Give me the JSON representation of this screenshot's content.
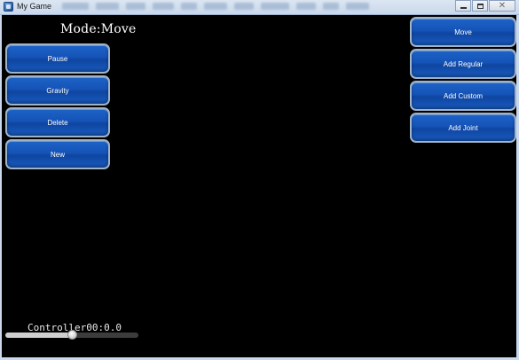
{
  "window": {
    "title": "My Game",
    "controls": {
      "minimize_icon": "minimize-icon",
      "maximize_icon": "maximize-icon",
      "close_glyph": "✕"
    }
  },
  "mode": {
    "text": "Mode:Move"
  },
  "left_buttons": [
    {
      "label": "Pause"
    },
    {
      "label": "Gravity"
    },
    {
      "label": "Delete"
    },
    {
      "label": "New"
    }
  ],
  "right_buttons": [
    {
      "label": "Move"
    },
    {
      "label": "Add Regular"
    },
    {
      "label": "Add Custom"
    },
    {
      "label": "Add Joint"
    }
  ],
  "controller": {
    "label": "Controller00:0.0",
    "slider_value": 0.5
  },
  "colors": {
    "button_blue": "#1553b6",
    "background": "#000000",
    "text": "#ffffff"
  }
}
